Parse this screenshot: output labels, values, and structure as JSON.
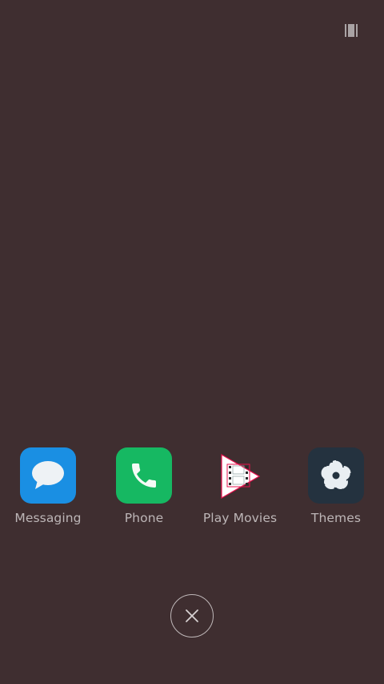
{
  "top_bar": {
    "recents_icon": "recents-grid-icon"
  },
  "apps": [
    {
      "label": "Messaging",
      "icon": "messaging-icon",
      "color": "#1a8fe3"
    },
    {
      "label": "Phone",
      "icon": "phone-icon",
      "color": "#16b862"
    },
    {
      "label": "Play Movies",
      "icon": "play-movies-icon",
      "color": "#e8114d"
    },
    {
      "label": "Themes",
      "icon": "themes-icon",
      "color": "#24323f"
    }
  ],
  "close_button": {
    "icon": "close-icon"
  },
  "colors": {
    "background": "#3f2e30",
    "label": "#bdb6b7"
  }
}
